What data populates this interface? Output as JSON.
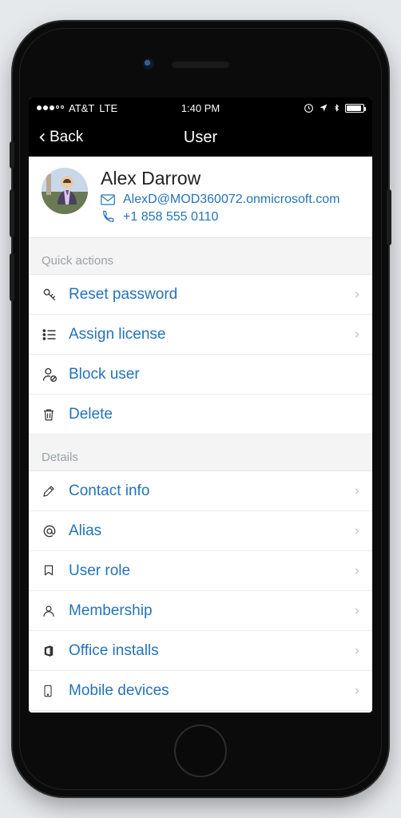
{
  "status_bar": {
    "carrier": "AT&T",
    "network": "LTE",
    "time": "1:40 PM",
    "signal_dots_filled": 3,
    "signal_dots_total": 5
  },
  "nav": {
    "back_label": "Back",
    "title": "User"
  },
  "profile": {
    "name": "Alex Darrow",
    "email": "AlexD@MOD360072.onmicrosoft.com",
    "phone": "+1 858 555 0110"
  },
  "sections": {
    "quick_actions": {
      "header": "Quick actions",
      "items": [
        {
          "icon": "key-icon",
          "label": "Reset password",
          "chevron": true
        },
        {
          "icon": "assign-icon",
          "label": "Assign license",
          "chevron": true
        },
        {
          "icon": "block-user-icon",
          "label": "Block user",
          "chevron": false
        },
        {
          "icon": "trash-icon",
          "label": "Delete",
          "chevron": false
        }
      ]
    },
    "details": {
      "header": "Details",
      "items": [
        {
          "icon": "pencil-icon",
          "label": "Contact info",
          "chevron": true
        },
        {
          "icon": "at-icon",
          "label": "Alias",
          "chevron": true
        },
        {
          "icon": "ribbon-icon",
          "label": "User role",
          "chevron": true
        },
        {
          "icon": "person-icon",
          "label": "Membership",
          "chevron": true
        },
        {
          "icon": "office-icon",
          "label": "Office installs",
          "chevron": true
        },
        {
          "icon": "mobile-icon",
          "label": "Mobile devices",
          "chevron": true
        }
      ]
    }
  },
  "colors": {
    "link": "#2573b8",
    "section_text": "#9da2a6",
    "bg": "#f4f4f4"
  }
}
